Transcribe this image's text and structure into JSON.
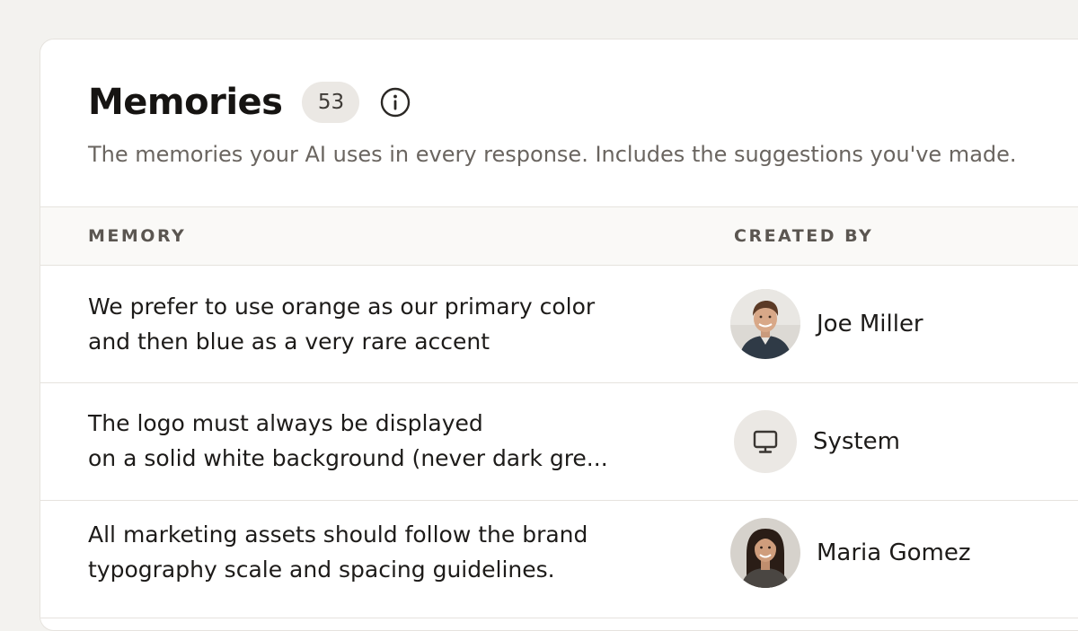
{
  "header": {
    "title": "Memories",
    "count": "53",
    "subtitle": "The memories your AI uses in every response. Includes the suggestions you've made."
  },
  "table": {
    "columns": [
      "MEMORY",
      "CREATED BY"
    ],
    "rows": [
      {
        "memory_lines": [
          "We prefer to use orange as our primary color",
          "and then blue as a very rare accent"
        ],
        "created_by": "Joe Miller",
        "avatar": "user-photo"
      },
      {
        "memory_lines": [
          "The logo must always be displayed",
          "on a solid white background (never dark gre..."
        ],
        "created_by": "System",
        "avatar": "monitor-icon"
      },
      {
        "memory_lines": [
          "All marketing assets should follow the brand",
          "typography scale and spacing guidelines."
        ],
        "created_by": "Maria Gomez",
        "avatar": "user-photo"
      }
    ]
  },
  "icons": {
    "info": "info-icon",
    "system": "monitor-icon"
  },
  "colors": {
    "page_bg": "#f3f2ef",
    "panel_bg": "#ffffff",
    "badge_bg": "#ebe8e4",
    "muted_text": "#6a6560"
  }
}
